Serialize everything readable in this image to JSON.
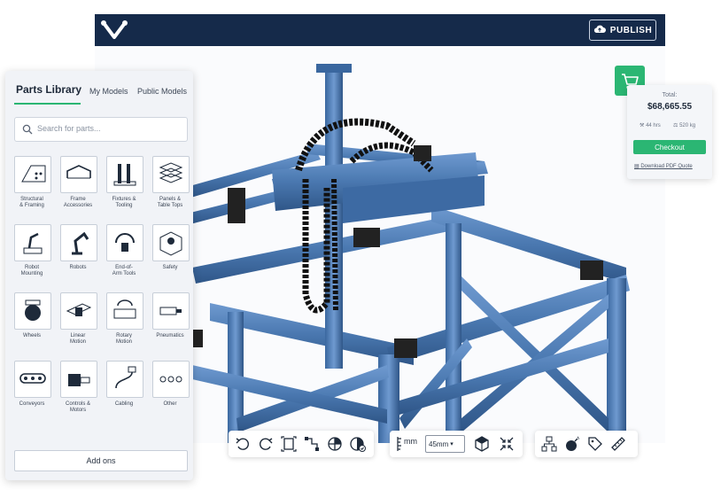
{
  "topbar": {
    "publish_label": "PUBLISH"
  },
  "sidebar": {
    "tabs": [
      {
        "label": "Parts Library"
      },
      {
        "label": "My Models"
      },
      {
        "label": "Public Models"
      }
    ],
    "search_placeholder": "Search for parts...",
    "categories": [
      {
        "label": "Structural\n& Framing",
        "icon": "framing-icon"
      },
      {
        "label": "Frame\nAccessories",
        "icon": "bracket-icon"
      },
      {
        "label": "Fixtures &\nTooling",
        "icon": "fixture-icon"
      },
      {
        "label": "Panels &\nTable Tops",
        "icon": "panels-icon"
      },
      {
        "label": "Robot\nMounting",
        "icon": "robot-mount-icon"
      },
      {
        "label": "Robots",
        "icon": "robot-arm-icon"
      },
      {
        "label": "End-of-\nArm Tools",
        "icon": "gripper-icon"
      },
      {
        "label": "Safety",
        "icon": "safety-icon"
      },
      {
        "label": "Wheels",
        "icon": "wheel-icon"
      },
      {
        "label": "Linear\nMotion",
        "icon": "linear-motion-icon"
      },
      {
        "label": "Rotary\nMotion",
        "icon": "rotary-motion-icon"
      },
      {
        "label": "Pneumatics",
        "icon": "pneumatics-icon"
      },
      {
        "label": "Conveyors",
        "icon": "conveyor-icon"
      },
      {
        "label": "Controls &\nMotors",
        "icon": "motor-icon"
      },
      {
        "label": "Cabling",
        "icon": "cable-icon"
      },
      {
        "label": "Other",
        "icon": "more-icon"
      }
    ],
    "addons_label": "Add ons"
  },
  "order": {
    "total_label": "Total:",
    "total_value": "$68,665.55",
    "lead_time": "44 hrs",
    "weight": "520 kg",
    "checkout_label": "Checkout",
    "pdf_label": "Download PDF Quote"
  },
  "toolbar": {
    "unit_label": "mm",
    "size_value": "45mm"
  },
  "colors": {
    "accent": "#2bb673",
    "navy": "#152a4a",
    "frame_blue": "#4a78b0"
  }
}
